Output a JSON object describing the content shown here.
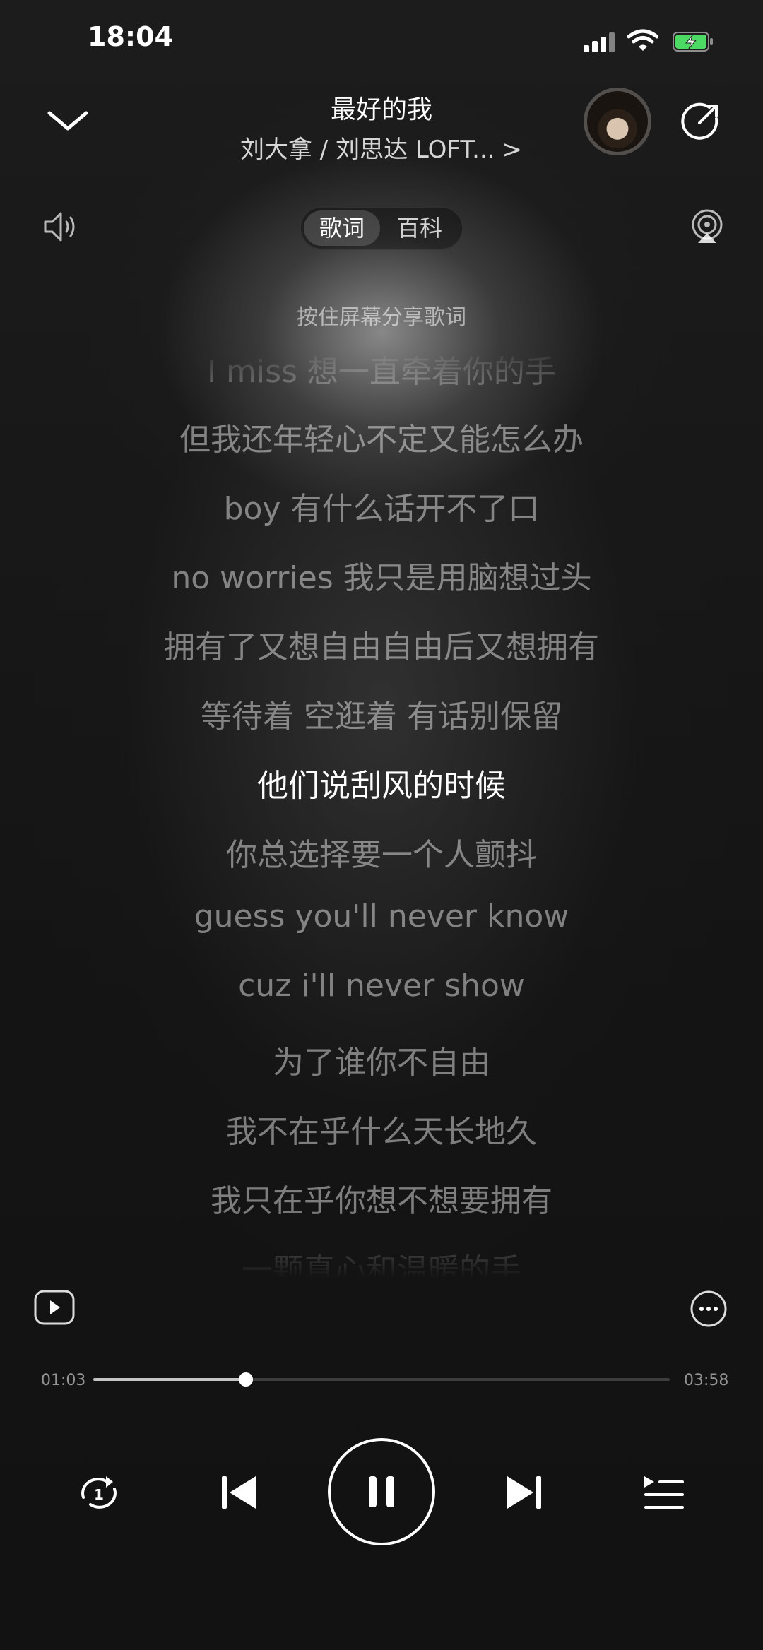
{
  "status_bar": {
    "time": "18:04",
    "icons": [
      "cellular-signal-icon",
      "wifi-icon",
      "battery-charging-icon"
    ],
    "battery_color": "#4cd964"
  },
  "header": {
    "title": "最好的我",
    "artist": "刘大拿 / 刘思达 LOFT...",
    "artist_chevron": ">",
    "icons": [
      "chevron-down-icon",
      "share-icon"
    ]
  },
  "tabs": {
    "items": [
      {
        "label": "歌词",
        "active": true
      },
      {
        "label": "百科",
        "active": false
      }
    ],
    "icons": [
      "volume-icon",
      "airplay-icon"
    ]
  },
  "hint": "按住屏幕分享歌词",
  "lyrics": {
    "current_index": 6,
    "lines": [
      "I miss 想一直牵着你的手",
      "但我还年轻心不定又能怎么办",
      "boy 有什么话开不了口",
      "no worries 我只是用脑想过头",
      "拥有了又想自由自由后又想拥有",
      "等待着 空逛着 有话别保留",
      "他们说刮风的时候",
      "你总选择要一个人颤抖",
      "guess you'll never know",
      "cuz i'll never show",
      "为了谁你不自由",
      "我不在乎什么天长地久",
      "我只在乎你想不想要拥有",
      "一颗真心和温暖的手"
    ]
  },
  "progress": {
    "elapsed": "01:03",
    "total": "03:58",
    "fraction": 0.265
  },
  "controls": {
    "icons": [
      "play-video-icon",
      "more-icon",
      "repeat-one-icon",
      "previous-icon",
      "pause-icon",
      "next-icon",
      "queue-icon"
    ],
    "repeat_badge": "1",
    "state": "playing"
  }
}
